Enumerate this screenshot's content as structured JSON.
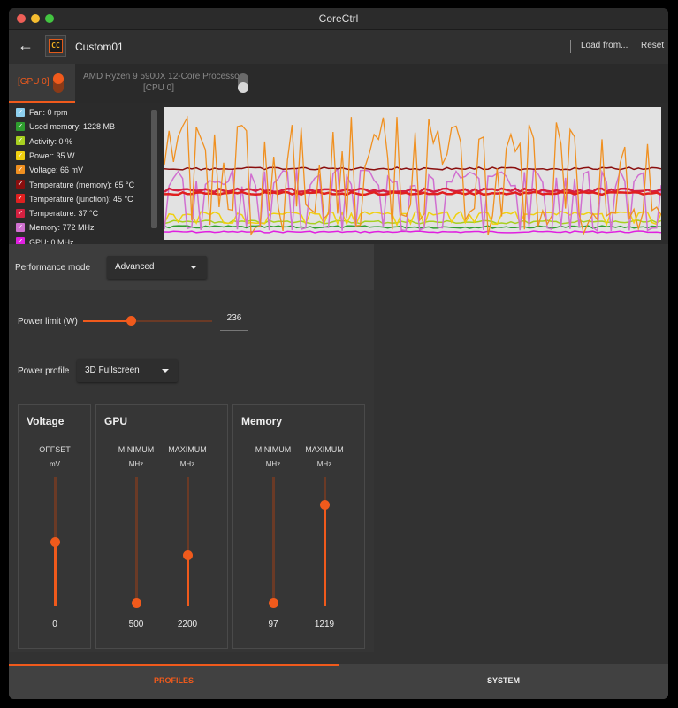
{
  "window": {
    "title": "CoreCtrl"
  },
  "header": {
    "back_icon": "arrow-left",
    "profile_name": "Custom01",
    "load_from": "Load from...",
    "reset": "Reset"
  },
  "tabs": [
    {
      "label": "[GPU 0]",
      "active": true,
      "enabled": true
    },
    {
      "label_line1": "AMD Ryzen 9 5900X 12-Core Processor",
      "label_line2": "[CPU 0]",
      "active": false,
      "enabled": false
    }
  ],
  "sensors": [
    {
      "label": "Fan: 0 rpm",
      "color": "#8ecfee"
    },
    {
      "label": "Used memory: 1228 MB",
      "color": "#2e9e2e"
    },
    {
      "label": "Activity: 0 %",
      "color": "#a8d020"
    },
    {
      "label": "Power: 35 W",
      "color": "#f0d010"
    },
    {
      "label": "Voltage: 66 mV",
      "color": "#f09020"
    },
    {
      "label": "Temperature (memory): 65 °C",
      "color": "#8a0e0e"
    },
    {
      "label": "Temperature (junction): 45 °C",
      "color": "#e02020"
    },
    {
      "label": "Temperature: 37 °C",
      "color": "#d42040"
    },
    {
      "label": "Memory: 772 MHz",
      "color": "#d070d0"
    },
    {
      "label": "GPU: 0 MHz",
      "color": "#e020e0"
    }
  ],
  "performance_mode": {
    "label": "Performance mode",
    "value": "Advanced"
  },
  "power_limit": {
    "label": "Power limit (W)",
    "value": "236",
    "fraction": 0.37
  },
  "power_profile": {
    "label": "Power profile",
    "value": "3D Fullscreen"
  },
  "voltage": {
    "title": "Voltage",
    "col_label": "OFFSET",
    "unit": "mV",
    "value": "0",
    "fraction": 0.5
  },
  "gpu": {
    "title": "GPU",
    "min_label": "MINIMUM",
    "max_label": "MAXIMUM",
    "unit": "MHz",
    "min_value": "500",
    "max_value": "2200",
    "min_fraction": 0.03,
    "max_fraction": 0.4
  },
  "memory": {
    "title": "Memory",
    "min_label": "MINIMUM",
    "max_label": "MAXIMUM",
    "unit": "MHz",
    "min_value": "97",
    "max_value": "1219",
    "min_fraction": 0.03,
    "max_fraction": 0.79
  },
  "bottom_tabs": [
    {
      "label": "PROFILES",
      "active": true
    },
    {
      "label": "SYSTEM",
      "active": false
    }
  ]
}
